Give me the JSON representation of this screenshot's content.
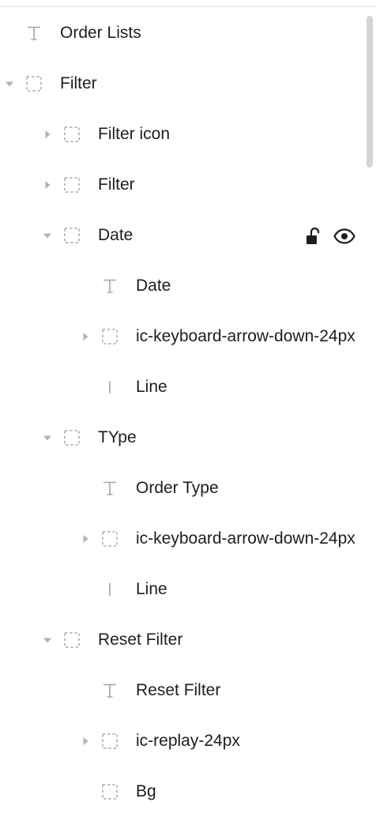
{
  "layers": [
    {
      "label": "Order Lists",
      "type": "text",
      "depth": 0,
      "chevron": "none"
    },
    {
      "label": "Filter",
      "type": "frame",
      "depth": 0,
      "chevron": "down"
    },
    {
      "label": "Filter icon",
      "type": "frame",
      "depth": 1,
      "chevron": "right"
    },
    {
      "label": "Filter",
      "type": "frame",
      "depth": 1,
      "chevron": "right"
    },
    {
      "label": "Date",
      "type": "frame",
      "depth": 1,
      "chevron": "down",
      "actions": [
        "unlock-icon",
        "eye-icon"
      ]
    },
    {
      "label": "Date",
      "type": "text",
      "depth": 2,
      "chevron": "none"
    },
    {
      "label": "ic-keyboard-arrow-down-24px",
      "type": "frame",
      "depth": 2,
      "chevron": "right"
    },
    {
      "label": "Line",
      "type": "line",
      "depth": 2,
      "chevron": "none"
    },
    {
      "label": "TYpe",
      "type": "frame",
      "depth": 1,
      "chevron": "down"
    },
    {
      "label": "Order Type",
      "type": "text",
      "depth": 2,
      "chevron": "none"
    },
    {
      "label": "ic-keyboard-arrow-down-24px",
      "type": "frame",
      "depth": 2,
      "chevron": "right"
    },
    {
      "label": "Line",
      "type": "line",
      "depth": 2,
      "chevron": "none"
    },
    {
      "label": "Reset Filter",
      "type": "frame",
      "depth": 1,
      "chevron": "down"
    },
    {
      "label": "Reset Filter",
      "type": "text",
      "depth": 2,
      "chevron": "none"
    },
    {
      "label": "ic-replay-24px",
      "type": "frame",
      "depth": 2,
      "chevron": "right"
    },
    {
      "label": "Bg",
      "type": "frame",
      "depth": 2,
      "chevron": "none"
    }
  ],
  "colors": {
    "text": "#1e1e1e",
    "icon": "#a6a6a6",
    "chevron": "#b3b3b3",
    "action": "#1e1e1e",
    "scrollbar": "#d4d4d4"
  }
}
